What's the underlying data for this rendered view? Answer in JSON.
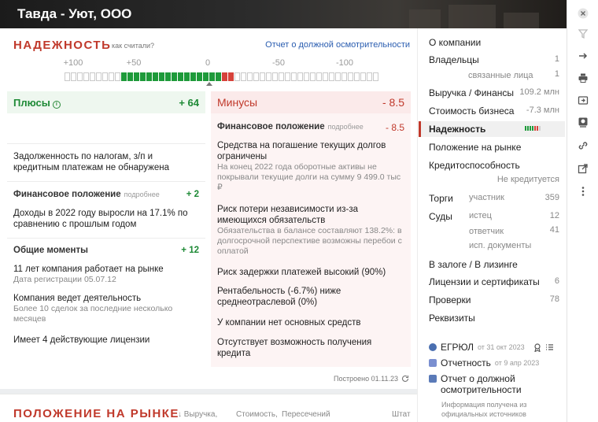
{
  "company": {
    "name": "Тавда - Уют, ООО"
  },
  "reliability": {
    "title": "НАДЕЖНОСТЬ",
    "how_calc": "как считали?",
    "report_link": "Отчет о должной осмотрительности",
    "scale": [
      "+100",
      "+50",
      "0",
      "-50",
      "-100"
    ],
    "bar": {
      "positive_segments": 16,
      "negative_segments": 2,
      "segments_per_side": 25
    },
    "pluses": {
      "title": "Плюсы",
      "score": "+ 64",
      "tax_text": "Задолженность по налогам, з/п и кредитным платежам не обнаружена",
      "fin_group": {
        "title": "Финансовое положение",
        "more": "подробнее",
        "score": "+ 2"
      },
      "fin_text": "Доходы в 2022 году выросли на 17.1% по сравнению с прошлым годом",
      "general_group": {
        "title": "Общие моменты",
        "score": "+ 12"
      },
      "items": [
        {
          "text": "11 лет компания работает на рынке",
          "sub": "Дата регистрации 05.07.12"
        },
        {
          "text": "Компания ведет деятельность",
          "sub": "Более 10 сделок за последние несколько месяцев"
        },
        {
          "text": "Имеет 4 действующие лицензии",
          "sub": ""
        }
      ]
    },
    "minuses": {
      "title": "Минусы",
      "score": "- 8.5",
      "fin_group": {
        "title": "Финансовое положение",
        "more": "подробнее",
        "score": "- 8.5"
      },
      "items": [
        {
          "text": "Средства на погашение текущих долгов ограничены",
          "sub": "На конец 2022 года оборотные активы не покрывали текущие долги на сумму 9 499.0 тыс ₽"
        },
        {
          "text": "Риск потери независимости из-за имеющихся обязательств",
          "sub": "Обязательства в балансе составляют 138.2%: в долгосрочной перспективе возможны перебои с оплатой"
        },
        {
          "text": "Риск задержки платежей высокий (90%)",
          "sub": ""
        },
        {
          "text": "Рентабельность (-6.7%) ниже среднеотраслевой (0%)",
          "sub": ""
        },
        {
          "text": "У компании нет основных средств",
          "sub": ""
        },
        {
          "text": "Отсутствует возможность получения кредита",
          "sub": ""
        }
      ]
    },
    "built": "Построено 01.11.23"
  },
  "market": {
    "title": "ПОЛОЖЕНИЕ НА РЫНКЕ",
    "cols": [
      "↓ Выручка,",
      "Стоимость,",
      "Пересечений",
      "Штат"
    ]
  },
  "sidebar": {
    "about": "О компании",
    "owners": {
      "label": "Владельцы",
      "count": "1"
    },
    "related": {
      "label": "связанные лица",
      "count": "1"
    },
    "revenue": {
      "label": "Выручка / Финансы",
      "value": "109.2 млн"
    },
    "value": {
      "label": "Стоимость бизнеса",
      "value": "-7.3 млн"
    },
    "reliability": "Надежность",
    "market": "Положение на рынке",
    "credit": {
      "label": "Кредитоспособность",
      "sub": "Не кредитуется"
    },
    "trades": {
      "label": "Торги",
      "sub": "участник",
      "count": "359"
    },
    "courts": {
      "label": "Суды",
      "plaintiff": "истец",
      "plaintiff_count": "12",
      "defendant": "ответчик",
      "defendant_count": "41",
      "enforcement": "исп. документы"
    },
    "pledge": "В залоге / В лизинге",
    "licenses": {
      "label": "Лицензии и сертификаты",
      "count": "6"
    },
    "checks": {
      "label": "Проверки",
      "count": "78"
    },
    "requisites": "Реквизиты",
    "egrul": {
      "label": "ЕГРЮЛ",
      "date": "от 31 окт 2023"
    },
    "reporting": {
      "label": "Отчетность",
      "date": "от 9 апр 2023"
    },
    "due_report": {
      "label": "Отчет о должной осмотрительности",
      "info": "Информация получена из официальных источников"
    }
  },
  "colors": {
    "accent": "#c0392b",
    "positive": "#1e9a3a",
    "link": "#2a5db0"
  }
}
